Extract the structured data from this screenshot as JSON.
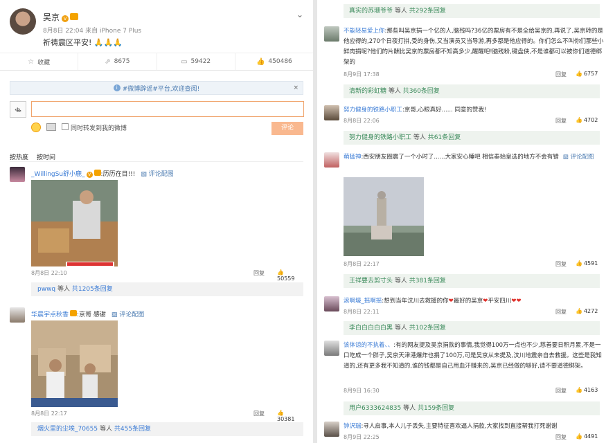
{
  "post": {
    "author": "吴京",
    "meta": "8月8日 22:04 来自 iPhone 7 Plus",
    "text": "祈祷震区平安!",
    "emoji": "🙏🙏🙏"
  },
  "actions": [
    {
      "icon": "star-icon",
      "label": "收藏"
    },
    {
      "icon": "share-icon",
      "label": "8675"
    },
    {
      "icon": "comment-icon",
      "label": "59422"
    },
    {
      "icon": "thumbs-up-icon",
      "label": "450486"
    }
  ],
  "notice": {
    "text": "#微博辟谣#平台,欢迎查阅!",
    "close": "×"
  },
  "compose": {
    "placeholder": "",
    "repost_label": "同时转发到我的微博",
    "submit_label": "评论"
  },
  "sort": {
    "hot": "按热度",
    "time": "按时间"
  },
  "left_comments": [
    {
      "user": "_WillingSu舒小鹿_",
      "text": ":历历在目!!!",
      "tag": "评论配图",
      "time": "8月8日 22:10",
      "reply": "回复",
      "likes": "50559",
      "sub_user": "pwwq",
      "sub_mid": " 等人 ",
      "sub_count": "共1205条回复"
    },
    {
      "user": "华晨宇点秋香",
      "text": ":京哥 感谢",
      "tag": "评论配图",
      "time": "8月8日 22:17",
      "reply": "回复",
      "likes": "30381",
      "sub_user": "烟火里的尘埃_70655",
      "sub_mid": " 等人 ",
      "sub_count": "共455条回复"
    }
  ],
  "right_top_sub": {
    "user": "真实的苏珊爷爷",
    "mid": " 等人 ",
    "count": "共292条回复"
  },
  "right_comments": [
    {
      "user": "不能轻易爱上你",
      "text": ":那些叫吴京捐一个亿的人,脑残吗?36亿的票房有不是全给吴京的,再说了,吴京转的是他应得的,270个日夜打拼,受的身伤,又当演员又当导游,再多都是他应得的。你们怎么不叫你们那些小鲜肉捐呢?他们的片酬比吴京的票房都不知高多少,醒醒吧!脑残粉,键盘侠,不是谁都可以被你们道德绑架的",
      "time": "8月9日 17:38",
      "reply": "回复",
      "likes": "6757",
      "sub_user": "清新的彩虹糖",
      "sub_mid": " 等人 ",
      "sub_count": "共360条回复"
    },
    {
      "user": "努力健身的铁路小职工",
      "text": ":京哥,心眼真好...... 同意的赞我!",
      "time": "8月8日 22:06",
      "reply": "回复",
      "likes": "4702",
      "sub_user": "努力健身的铁路小职工",
      "sub_mid": " 等人 ",
      "sub_count": "共61条回复"
    },
    {
      "user": "萌猛神",
      "text": ":西安朋友圈震了一个小时了......大家安心睡吧 相信秦始皇选的地方不会有错",
      "tag": "评论配图",
      "time": "8月8日 22:17",
      "reply": "回复",
      "likes": "4591",
      "sub_user": "王祥要去剪寸头",
      "sub_mid": " 等人 ",
      "sub_count": "共381条回复"
    },
    {
      "user": "滚啊壕_摇啊摇",
      "text_a": ":想到当年汶川去救援的你",
      "text_b": "最好的吴京",
      "text_c": "平安四川",
      "time": "8月8日 22:11",
      "reply": "回复",
      "likes": "4272",
      "sub_user": "李白白白白白黑",
      "sub_mid": " 等人 ",
      "sub_count": "共102条回复"
    },
    {
      "user": "该体谅的不执着、、",
      "text": ":有的网友提及吴京捐款的事情,我觉得100万一点也不少,慈善要日积月累,不是一口吃成一个胖子,吴京天津港爆炸也捐了100万,可是吴京从未提及,汶川地震亲自去救援。这些是我知道的,还有更多我不知道的,谁的钱都是自己用血汗赚来的,吴京已经做的够好,请不要道德绑架。",
      "time": "8月9日 16:30",
      "reply": "回复",
      "likes": "4163",
      "sub_user": "用户6333624835",
      "sub_mid": " 等人 ",
      "sub_count": "共159条回复"
    },
    {
      "user": "钟沢瑞",
      "text": ":寻人启事,本人儿子丢失,主要特征喜欢逼人捐款,大家找到直接帮我打死谢谢",
      "time": "8月9日 22:25",
      "reply": "回复",
      "likes": "4491"
    }
  ],
  "colors": {
    "accent": "#eb7350",
    "link": "#3a7bd5",
    "green_link": "#3a8a5a"
  }
}
